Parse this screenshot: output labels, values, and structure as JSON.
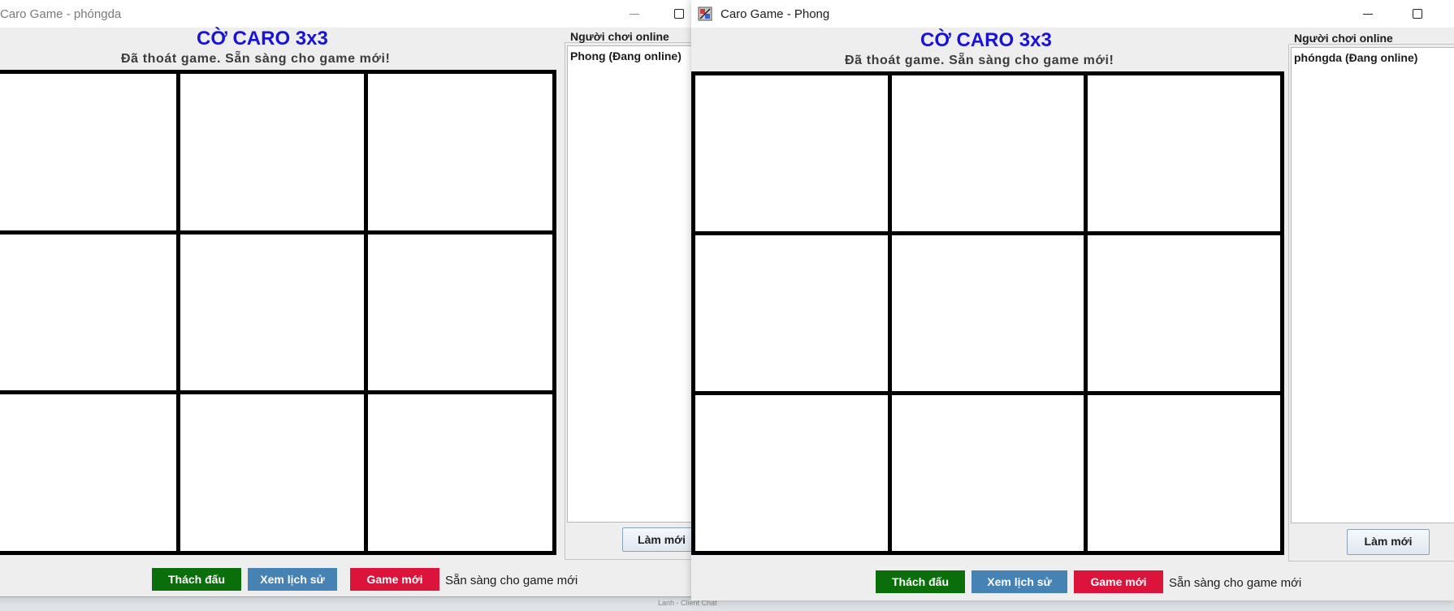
{
  "windows": [
    {
      "id": "left",
      "title": "Caro Game - phóngda",
      "game_title": "CỜ CARO 3x3",
      "status_message": "Đã thoát game. Sẵn sàng cho game mới!",
      "online_label": "Người chơi online",
      "online_players": [
        "Phong (Đang online)"
      ],
      "refresh_label": "Làm mới",
      "buttons": {
        "challenge": "Thách đấu",
        "history": "Xem lịch sử",
        "new_game": "Game mới"
      },
      "footer_status": "Sẵn sàng cho game mới",
      "board": [
        "",
        "",
        "",
        "",
        "",
        "",
        "",
        "",
        ""
      ]
    },
    {
      "id": "right",
      "title": "Caro Game - Phong",
      "game_title": "CỜ CARO 3x3",
      "status_message": "Đã thoát game. Sẵn sàng cho game mới!",
      "online_label": "Người chơi online",
      "online_players": [
        "phóngda (Đang online)"
      ],
      "refresh_label": "Làm mới",
      "buttons": {
        "challenge": "Thách đấu",
        "history": "Xem lịch sử",
        "new_game": "Game mới"
      },
      "footer_status": "Sẵn sàng cho game mới",
      "board": [
        "",
        "",
        "",
        "",
        "",
        "",
        "",
        "",
        ""
      ]
    }
  ],
  "taskbar": {
    "item_label": "Lanh - Client Chat"
  },
  "colors": {
    "title_blue": "#1a12d6",
    "challenge_green": "#0a6e0a",
    "history_blue": "#4682b4",
    "newgame_red": "#dc143c"
  }
}
